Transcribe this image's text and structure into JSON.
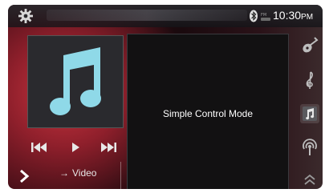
{
  "topbar": {
    "icon_settings": "gear-icon",
    "icon_bluetooth": "bluetooth-icon",
    "fm_label": "FM",
    "time": "10:30",
    "ampm": "PM"
  },
  "main": {
    "album_art_icon": "music-note-icon",
    "controls": {
      "prev_icon": "previous-track-icon",
      "play_icon": "play-icon",
      "next_icon": "next-track-icon"
    },
    "nav_next_icon": "chevron-right-icon",
    "video_link": "Video",
    "video_arrow_icon": "arrow-right-icon",
    "panel_text": "Simple Control Mode"
  },
  "side_menu": {
    "items": [
      {
        "icon": "guitar-icon"
      },
      {
        "icon": "treble-clef-icon"
      },
      {
        "icon": "music-note-icon",
        "selected": true
      },
      {
        "icon": "podcast-icon"
      },
      {
        "icon": "double-chevron-up-icon"
      }
    ]
  },
  "colors": {
    "accent_red": "#c9343f",
    "panel_bg": "#121112",
    "art_note": "#8fd9e8",
    "text": "#ffffff"
  }
}
